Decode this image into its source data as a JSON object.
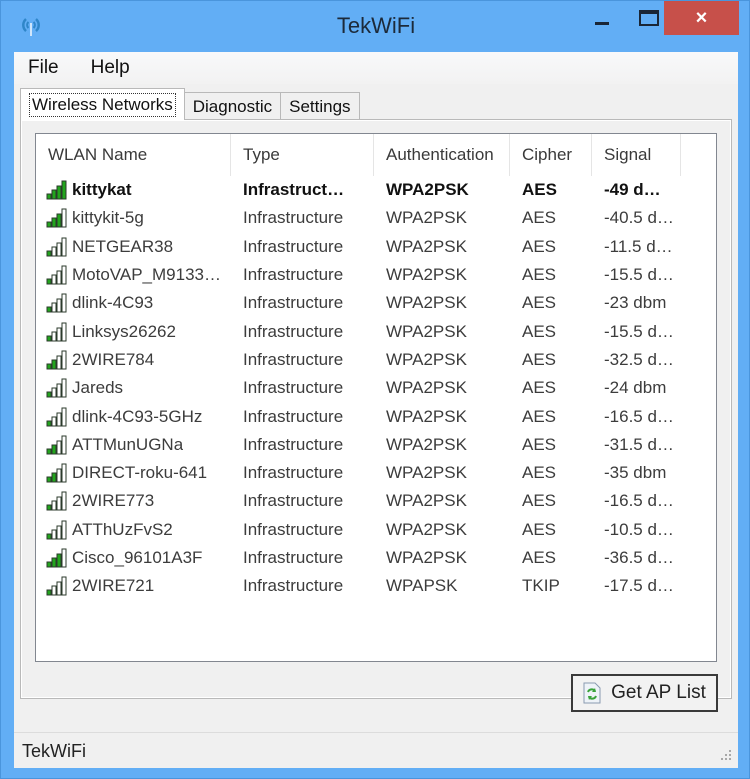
{
  "window": {
    "title": "TekWiFi",
    "app_icon": "wifi-antenna-icon",
    "controls": {
      "minimize": "minimize-icon",
      "maximize": "maximize-icon",
      "close": "×"
    }
  },
  "menubar": {
    "items": [
      "File",
      "Help"
    ]
  },
  "tabs": [
    {
      "label": "Wireless Networks",
      "active": true
    },
    {
      "label": "Diagnostic",
      "active": false
    },
    {
      "label": "Settings",
      "active": false
    }
  ],
  "list": {
    "columns": [
      "WLAN Name",
      "Type",
      "Authentication",
      "Cipher",
      "Signal"
    ],
    "rows": [
      {
        "name": "kittykat",
        "type": "Infrastruct…",
        "auth": "WPA2PSK",
        "cipher": "AES",
        "signal": "-49 d…",
        "bars": 4,
        "bold": true
      },
      {
        "name": "kittykit-5g",
        "type": "Infrastructure",
        "auth": "WPA2PSK",
        "cipher": "AES",
        "signal": "-40.5 d…",
        "bars": 3,
        "bold": false
      },
      {
        "name": "NETGEAR38",
        "type": "Infrastructure",
        "auth": "WPA2PSK",
        "cipher": "AES",
        "signal": "-11.5 d…",
        "bars": 1,
        "bold": false
      },
      {
        "name": "MotoVAP_M9133…",
        "type": "Infrastructure",
        "auth": "WPA2PSK",
        "cipher": "AES",
        "signal": "-15.5 d…",
        "bars": 1,
        "bold": false
      },
      {
        "name": "dlink-4C93",
        "type": "Infrastructure",
        "auth": "WPA2PSK",
        "cipher": "AES",
        "signal": "-23 dbm",
        "bars": 1,
        "bold": false
      },
      {
        "name": "Linksys26262",
        "type": "Infrastructure",
        "auth": "WPA2PSK",
        "cipher": "AES",
        "signal": "-15.5 d…",
        "bars": 1,
        "bold": false
      },
      {
        "name": "2WIRE784",
        "type": "Infrastructure",
        "auth": "WPA2PSK",
        "cipher": "AES",
        "signal": "-32.5 d…",
        "bars": 2,
        "bold": false
      },
      {
        "name": "Jareds",
        "type": "Infrastructure",
        "auth": "WPA2PSK",
        "cipher": "AES",
        "signal": "-24 dbm",
        "bars": 1,
        "bold": false
      },
      {
        "name": "dlink-4C93-5GHz",
        "type": "Infrastructure",
        "auth": "WPA2PSK",
        "cipher": "AES",
        "signal": "-16.5 d…",
        "bars": 1,
        "bold": false
      },
      {
        "name": "ATTMunUGNa",
        "type": "Infrastructure",
        "auth": "WPA2PSK",
        "cipher": "AES",
        "signal": "-31.5 d…",
        "bars": 2,
        "bold": false
      },
      {
        "name": "DIRECT-roku-641",
        "type": "Infrastructure",
        "auth": "WPA2PSK",
        "cipher": "AES",
        "signal": "-35 dbm",
        "bars": 2,
        "bold": false
      },
      {
        "name": "2WIRE773",
        "type": "Infrastructure",
        "auth": "WPA2PSK",
        "cipher": "AES",
        "signal": "-16.5 d…",
        "bars": 1,
        "bold": false
      },
      {
        "name": "ATThUzFvS2",
        "type": "Infrastructure",
        "auth": "WPA2PSK",
        "cipher": "AES",
        "signal": "-10.5 d…",
        "bars": 1,
        "bold": false
      },
      {
        "name": "Cisco_96101A3F",
        "type": "Infrastructure",
        "auth": "WPA2PSK",
        "cipher": "AES",
        "signal": "-36.5 d…",
        "bars": 3,
        "bold": false
      },
      {
        "name": "2WIRE721",
        "type": "Infrastructure",
        "auth": "WPAPSK",
        "cipher": "TKIP",
        "signal": "-17.5 d…",
        "bars": 1,
        "bold": false
      }
    ]
  },
  "buttons": {
    "get_ap_list": "Get AP List"
  },
  "statusbar": {
    "text": "TekWiFi"
  },
  "colors": {
    "signal_on": "#22a51d",
    "signal_off": "#ffffff",
    "close_button": "#c7504a",
    "titlebar": "#62aef5"
  }
}
